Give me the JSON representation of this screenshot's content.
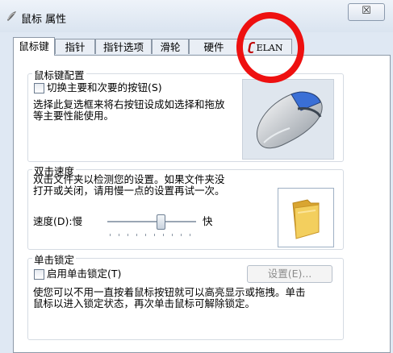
{
  "window": {
    "title": "鼠标 属性",
    "close_glyph": "☒"
  },
  "tabs": [
    {
      "label": "鼠标键"
    },
    {
      "label": "指针"
    },
    {
      "label": "指针选项"
    },
    {
      "label": "滑轮"
    },
    {
      "label": "硬件"
    },
    {
      "label": "ELAN",
      "icon": "elan-icon"
    }
  ],
  "button_config": {
    "title": "鼠标键配置",
    "checkbox_label": "切换主要和次要的按钮(S)",
    "description_line1": "选择此复选框来将右按钮设成如选择和拖放",
    "description_line2": "等主要性能使用。"
  },
  "double_click": {
    "title": "双击速度",
    "description_line1": "双击文件夹以检测您的设置。如果文件夹没",
    "description_line2": "打开或关闭，请用慢一点的设置再试一次。",
    "speed_label": "速度(D):慢",
    "fast_label": "快",
    "speed_value": 0.6
  },
  "click_lock": {
    "title": "单击锁定",
    "checkbox_label": "启用单击锁定(T)",
    "settings_button": "设置(E)...",
    "description_line1": "使您可以不用一直按着鼠标按钮就可以高亮显示或拖拽。单击",
    "description_line2": "鼠标以进入锁定状态，再次单击鼠标可解除锁定。"
  },
  "colors": {
    "annotation": "#ee1010",
    "folder": "#f0c64a"
  }
}
